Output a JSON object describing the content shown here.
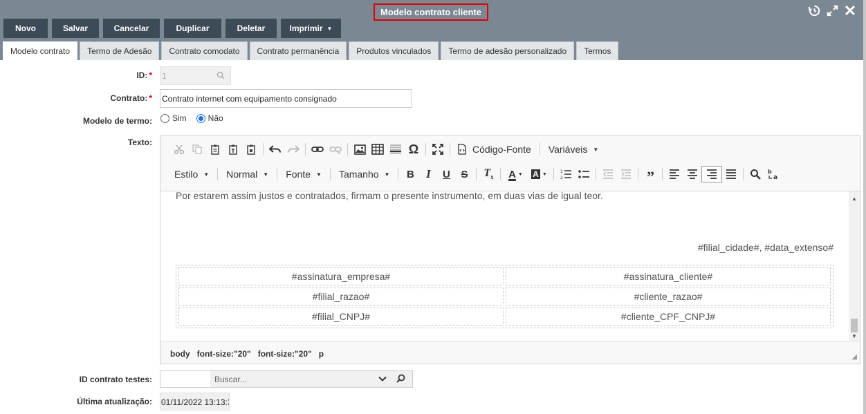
{
  "window": {
    "title": "Modelo contrato cliente",
    "icons": [
      "history-icon",
      "expand-icon",
      "close-icon"
    ]
  },
  "toolbar": {
    "buttons": [
      {
        "label": "Novo"
      },
      {
        "label": "Salvar"
      },
      {
        "label": "Cancelar"
      },
      {
        "label": "Duplicar"
      },
      {
        "label": "Deletar"
      },
      {
        "label": "Imprimir"
      }
    ]
  },
  "tabs": [
    {
      "label": "Modelo contrato",
      "active": true
    },
    {
      "label": "Termo de Adesão"
    },
    {
      "label": "Contrato comodato"
    },
    {
      "label": "Contrato permanência"
    },
    {
      "label": "Produtos vinculados"
    },
    {
      "label": "Termo de adesão personalizado"
    },
    {
      "label": "Termos"
    }
  ],
  "form": {
    "id_label": "ID:",
    "id_value": "1",
    "contrato_label": "Contrato:",
    "contrato_value": "Contrato internet com equipamento consignado",
    "modelo_termo_label": "Modelo de termo:",
    "option_sim": "Sim",
    "option_nao": "Não",
    "selected": "Não",
    "texto_label": "Texto:",
    "id_testes_label": "ID contrato testes:",
    "search_placeholder": "Buscar...",
    "ultima_label": "Última atualização:",
    "ultima_value": "01/11/2022 13:13:3"
  },
  "editor": {
    "codigo_fonte": "Código-Fonte",
    "variaveis": "Variáveis",
    "estilo": "Estilo",
    "normal": "Normal",
    "fonte": "Fonte",
    "tamanho": "Tamanho",
    "content": {
      "paragraph": "Por estarem assim justos e contratados, firmam o presente instrumento, em duas vias de igual teor.",
      "right_line": "#filial_cidade#, #data_extenso#",
      "signature_rows": [
        [
          "#assinatura_empresa#",
          "#assinatura_cliente#"
        ],
        [
          "#filial_razao#",
          "#cliente_razao#"
        ],
        [
          "#filial_CNPJ#",
          "#cliente_CPF_CNPJ#"
        ]
      ]
    },
    "status_path": [
      "body",
      "font-size:\"20\"",
      "font-size:\"20\"",
      "p"
    ]
  },
  "colors": {
    "header_bg": "#7b8793",
    "button_bg": "#3d4a57",
    "title_highlight": "#e00000",
    "radio_selected": "#1a73e8",
    "required_mark": "#d40000"
  }
}
